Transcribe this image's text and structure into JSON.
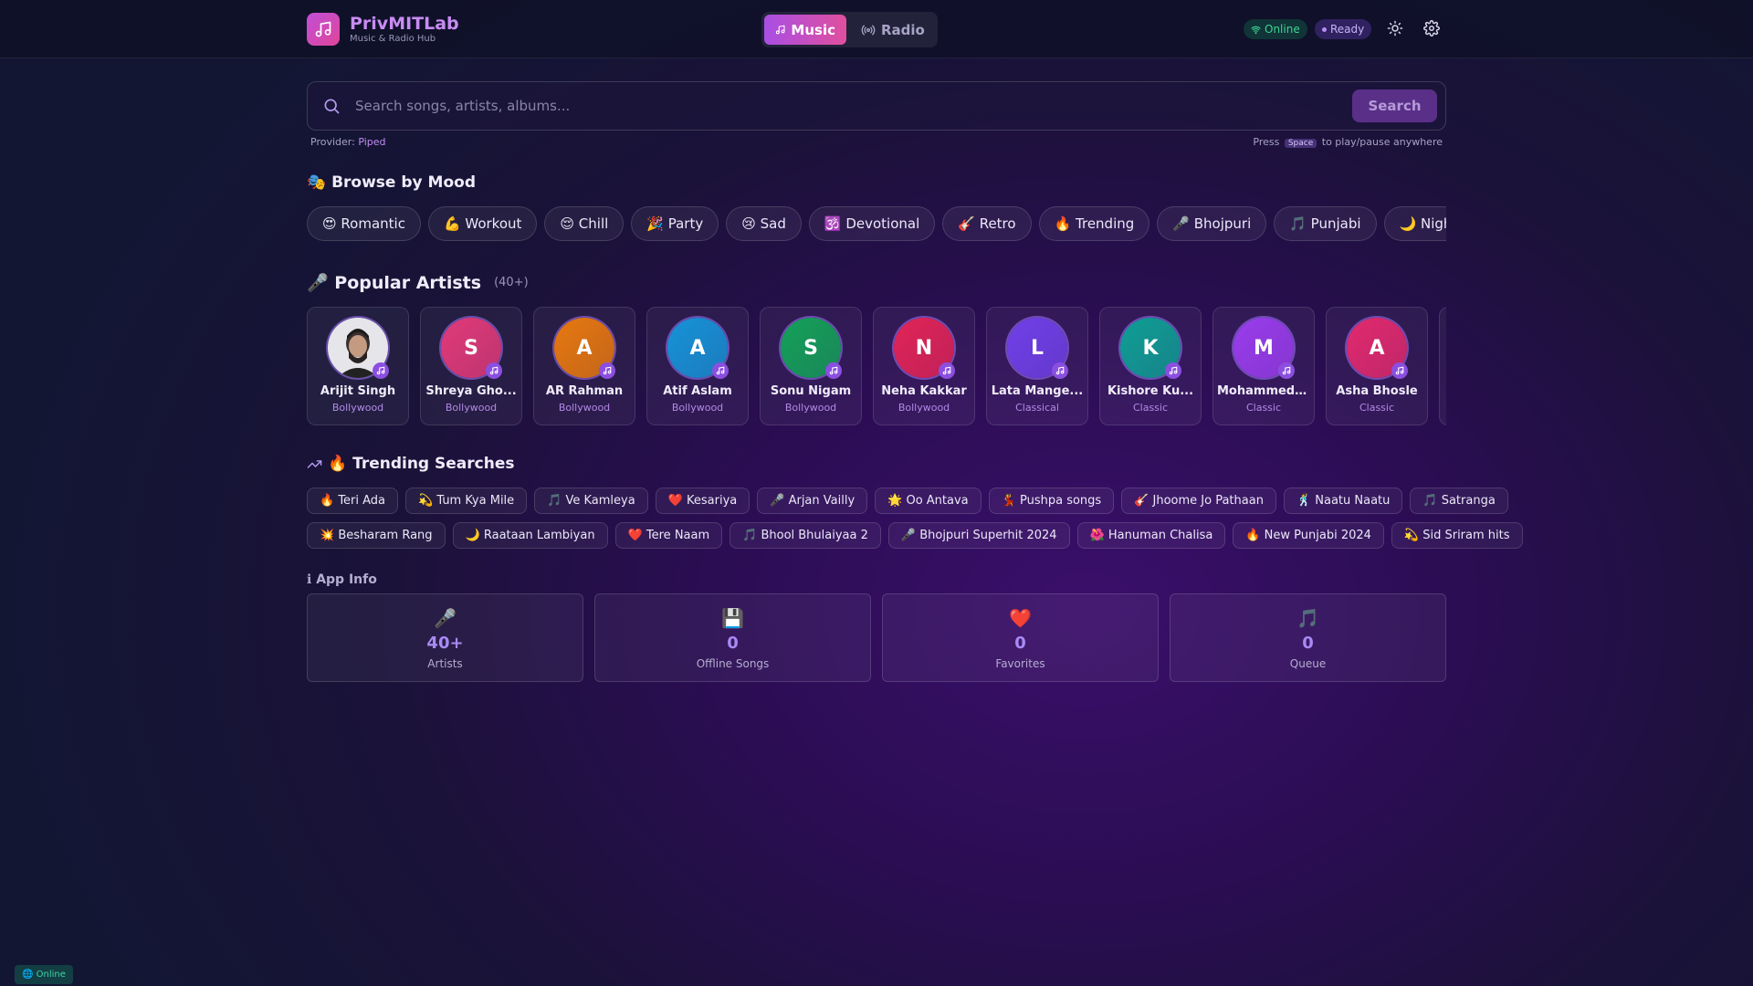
{
  "header": {
    "app_name": "PrivMITLab",
    "tagline": "Music & Radio Hub",
    "modes": [
      {
        "label": "Music",
        "active": true
      },
      {
        "label": "Radio",
        "active": false
      }
    ],
    "status_online": "Online",
    "status_ready": "Ready"
  },
  "search": {
    "placeholder": "Search songs, artists, albums...",
    "button_label": "Search",
    "provider_label": "Provider:",
    "provider_value": "Piped",
    "hint_before": "Press",
    "hint_key": "Space",
    "hint_after": "to play/pause anywhere"
  },
  "moods": {
    "title": "🎭 Browse by Mood",
    "items": [
      "😍 Romantic",
      "💪 Workout",
      "😌 Chill",
      "🎉 Party",
      "😢 Sad",
      "🕉️ Devotional",
      "🎸 Retro",
      "🔥 Trending",
      "🎤 Bhojpuri",
      "🎵 Punjabi",
      "🌙 Night",
      "🎶"
    ]
  },
  "artists": {
    "title": "🎤 Popular Artists",
    "count": "(40+)",
    "items": [
      {
        "name": "Arijit Singh",
        "genre": "Bollywood",
        "initial": "",
        "color": "#d9d9df"
      },
      {
        "name": "Shreya Gho...",
        "genre": "Bollywood",
        "initial": "S",
        "color": "#e23a7a"
      },
      {
        "name": "AR Rahman",
        "genre": "Bollywood",
        "initial": "A",
        "color": "#e8780f"
      },
      {
        "name": "Atif Aslam",
        "genre": "Bollywood",
        "initial": "A",
        "color": "#1793d8"
      },
      {
        "name": "Sonu Nigam",
        "genre": "Bollywood",
        "initial": "S",
        "color": "#14a159"
      },
      {
        "name": "Neha Kakkar",
        "genre": "Bollywood",
        "initial": "N",
        "color": "#e22457"
      },
      {
        "name": "Lata Mange...",
        "genre": "Classical",
        "initial": "L",
        "color": "#7040e8"
      },
      {
        "name": "Kishore Ku...",
        "genre": "Classic",
        "initial": "K",
        "color": "#0f9e95"
      },
      {
        "name": "Mohammed ...",
        "genre": "Classic",
        "initial": "M",
        "color": "#9a3ded"
      },
      {
        "name": "Asha Bhosle",
        "genre": "Classic",
        "initial": "A",
        "color": "#e22a6e"
      },
      {
        "name": "",
        "genre": "",
        "initial": "",
        "color": "#6a4fd8"
      }
    ]
  },
  "trending": {
    "title": "🔥 Trending Searches",
    "row1": [
      "🔥 Teri Ada",
      "💫 Tum Kya Mile",
      "🎵 Ve Kamleya",
      "❤️ Kesariya",
      "🎤 Arjan Vailly",
      "🌟 Oo Antava",
      "💃 Pushpa songs",
      "🎸 Jhoome Jo Pathaan",
      "🕺 Naatu Naatu",
      "🎵 Satranga"
    ],
    "row2": [
      "💥 Besharam Rang",
      "🌙 Raataan Lambiyan",
      "❤️ Tere Naam",
      "🎵 Bhool Bhulaiyaa 2",
      "🎤 Bhojpuri Superhit 2024",
      "🌺 Hanuman Chalisa",
      "🔥 New Punjabi 2024",
      "💫 Sid Sriram hits"
    ]
  },
  "app_info": {
    "title": "ℹ App Info",
    "cards": [
      {
        "icon": "🎤",
        "value": "40+",
        "label": "Artists"
      },
      {
        "icon": "💾",
        "value": "0",
        "label": "Offline Songs"
      },
      {
        "icon": "❤️",
        "value": "0",
        "label": "Favorites"
      },
      {
        "icon": "🎵",
        "value": "0",
        "label": "Queue"
      }
    ]
  },
  "footer": {
    "status": "🌐 Online"
  }
}
